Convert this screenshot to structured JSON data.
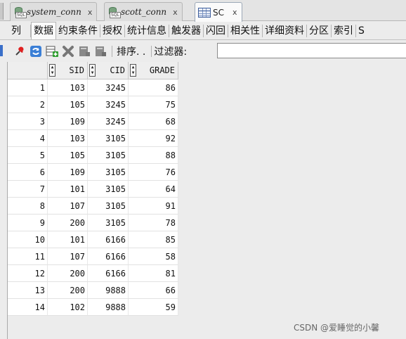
{
  "doc_tabs": [
    {
      "label": "system_conn",
      "close": "x",
      "tag": "SQL"
    },
    {
      "label": "scott_conn",
      "close": "x",
      "tag": "SQL"
    },
    {
      "label": "SC",
      "close": "x"
    }
  ],
  "sub_tabs": [
    "列",
    "数据",
    "约束条件",
    "授权",
    "统计信息",
    "触发器",
    "闪回",
    "相关性",
    "详细资料",
    "分区",
    "索引",
    "S"
  ],
  "active_sub_tab": "数据",
  "toolbar": {
    "icons": [
      "pin-icon",
      "refresh-icon",
      "insert-row-icon",
      "delete-row-icon",
      "commit-icon",
      "rollback-icon"
    ],
    "sort_label": "排序. .",
    "filter_label": "过滤器:",
    "filter_value": ""
  },
  "grid": {
    "columns": [
      "SID",
      "CID",
      "GRADE"
    ],
    "rows": [
      {
        "n": "1",
        "sid": "103",
        "cid": "3245",
        "grade": "86"
      },
      {
        "n": "2",
        "sid": "105",
        "cid": "3245",
        "grade": "75"
      },
      {
        "n": "3",
        "sid": "109",
        "cid": "3245",
        "grade": "68"
      },
      {
        "n": "4",
        "sid": "103",
        "cid": "3105",
        "grade": "92"
      },
      {
        "n": "5",
        "sid": "105",
        "cid": "3105",
        "grade": "88"
      },
      {
        "n": "6",
        "sid": "109",
        "cid": "3105",
        "grade": "76"
      },
      {
        "n": "7",
        "sid": "101",
        "cid": "3105",
        "grade": "64"
      },
      {
        "n": "8",
        "sid": "107",
        "cid": "3105",
        "grade": "91"
      },
      {
        "n": "9",
        "sid": "200",
        "cid": "3105",
        "grade": "78"
      },
      {
        "n": "10",
        "sid": "101",
        "cid": "6166",
        "grade": "85"
      },
      {
        "n": "11",
        "sid": "107",
        "cid": "6166",
        "grade": "58"
      },
      {
        "n": "12",
        "sid": "200",
        "cid": "6166",
        "grade": "81"
      },
      {
        "n": "13",
        "sid": "200",
        "cid": "9888",
        "grade": "66"
      },
      {
        "n": "14",
        "sid": "102",
        "cid": "9888",
        "grade": "59"
      }
    ]
  },
  "watermark": "CSDN @爱睡觉的小馨"
}
